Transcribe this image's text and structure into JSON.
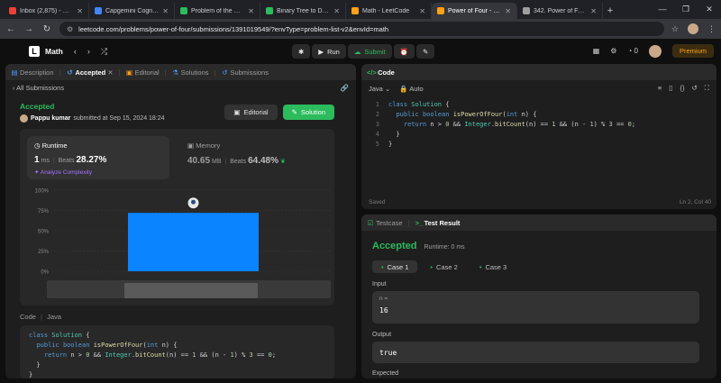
{
  "browser": {
    "tabs": [
      {
        "label": "Inbox (2,875) - mrpa",
        "color": "#ea4335"
      },
      {
        "label": "Capgemini Cognitive",
        "color": "#4285f4"
      },
      {
        "label": "Problem of the Day |",
        "color": "#2cbb5d"
      },
      {
        "label": "Binary Tree to DLL |",
        "color": "#2cbb5d"
      },
      {
        "label": "Math - LeetCode",
        "color": "#ffa116"
      },
      {
        "label": "Power of Four - Leet",
        "color": "#ffa116",
        "active": true
      },
      {
        "label": "342. Power of Four -",
        "color": "#9e9e9e"
      }
    ],
    "url": "leetcode.com/problems/power-of-four/submissions/1391019549/?envType=problem-list-v2&envId=math"
  },
  "lcnav": {
    "title": "Math",
    "run_label": "Run",
    "submit_label": "Submit",
    "coins": "0",
    "premium_label": "Premium"
  },
  "left_panel": {
    "tabs": [
      {
        "label": "Description",
        "icon": "description-icon"
      },
      {
        "label": "Accepted",
        "icon": "history-icon",
        "active": true
      },
      {
        "label": "Editorial",
        "icon": "book-icon"
      },
      {
        "label": "Solutions",
        "icon": "flask-icon"
      },
      {
        "label": "Submissions",
        "icon": "history-icon"
      }
    ],
    "back_label": "All Submissions",
    "status": "Accepted",
    "user": "Pappu kumar",
    "submitted_text": "submitted at Sep 15, 2024 18:24",
    "editorial_btn": "Editorial",
    "solution_btn": "Solution",
    "runtime": {
      "label": "Runtime",
      "value": "1",
      "unit": "ms",
      "beats_label": "Beats",
      "beats_value": "28.27%",
      "analyze": "Analyze Complexity"
    },
    "memory": {
      "label": "Memory",
      "value": "40.65",
      "unit": "MB",
      "beats_label": "Beats",
      "beats_value": "64.48%"
    },
    "chart_axis": [
      "100%",
      "75%",
      "50%",
      "25%",
      "0%"
    ],
    "code_header": {
      "code": "Code",
      "lang": "Java"
    },
    "code_lines": [
      "class Solution {",
      "  public boolean isPowerOfFour(int n) {",
      "    return n > 0 && Integer.bitCount(n) == 1 && (n - 1) % 3 == 0;",
      "  }",
      "}"
    ]
  },
  "chart_data": {
    "type": "bar",
    "categories": [
      "1 ms"
    ],
    "values": [
      72
    ],
    "ylim": [
      0,
      100
    ],
    "yticks": [
      "100%",
      "75%",
      "50%",
      "25%",
      "0%"
    ],
    "bar_color": "#0a84ff"
  },
  "code_panel": {
    "title": "Code",
    "language": "Java",
    "mode": "Auto",
    "lines": [
      "class Solution {",
      "  public boolean isPowerOfFour(int n) {",
      "    return n > 0 && Integer.bitCount(n) == 1 && (n - 1) % 3 == 0;",
      "  }",
      "}"
    ],
    "status_left": "Saved",
    "status_right": "Ln 2, Col 40"
  },
  "result_panel": {
    "tab_testcase": "Testcase",
    "tab_result": "Test Result",
    "status": "Accepted",
    "runtime": "Runtime: 0 ms",
    "cases": [
      "Case 1",
      "Case 2",
      "Case 3"
    ],
    "input_label": "Input",
    "input_var": "n =",
    "input_value": "16",
    "output_label": "Output",
    "output_value": "true",
    "expected_label": "Expected"
  }
}
